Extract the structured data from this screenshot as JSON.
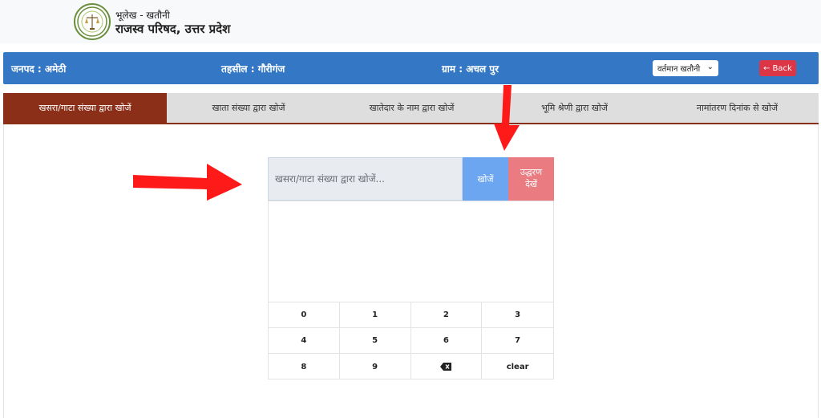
{
  "header": {
    "subtitle": "भूलेख - खतौनी",
    "title": "राजस्व परिषद, उत्तर प्रदेश"
  },
  "location": {
    "district": "जनपद : अमेठी",
    "tehsil": "तहसील : गौरीगंज",
    "village": "ग्राम : अचल पुर",
    "khatauni_select": "वर्तमान खतौनी",
    "back_label": "Back"
  },
  "tabs": [
    {
      "label": "खसरा/गाटा संख्या द्वारा खोजें",
      "active": true
    },
    {
      "label": "खाता संख्या द्वारा खोजें",
      "active": false
    },
    {
      "label": "खातेदार के नाम द्वारा खोजें",
      "active": false
    },
    {
      "label": "भूमि श्रेणी द्वारा खोजें",
      "active": false
    },
    {
      "label": "नामांतरण दिनांक से खोजें",
      "active": false
    }
  ],
  "search": {
    "placeholder": "खसरा/गाटा संख्या द्वारा खोजें...",
    "search_label": "खोजें",
    "example_label": "उद्धरण देखें"
  },
  "keypad": [
    "0",
    "1",
    "2",
    "3",
    "4",
    "5",
    "6",
    "7",
    "8",
    "9",
    "backspace-icon",
    "clear"
  ],
  "colors": {
    "blue_bar": "#3478c5",
    "active_tab": "#8b2f19",
    "search_button": "#6ca6f0",
    "example_button": "#ea7b80",
    "back_button": "#dc3545",
    "arrow": "#ff1a1a"
  }
}
